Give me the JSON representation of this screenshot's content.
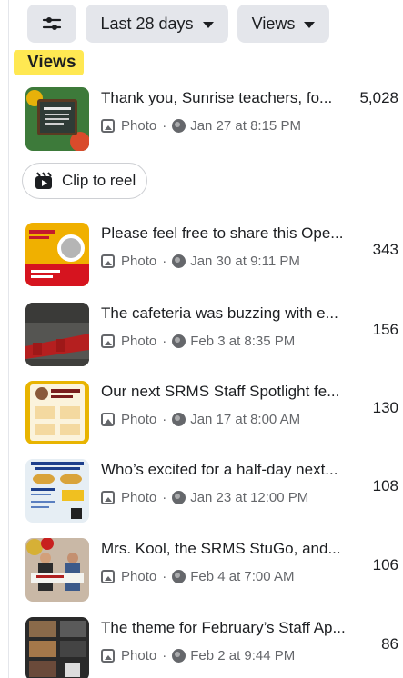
{
  "filters": {
    "date_range": "Last 28 days",
    "metric": "Views"
  },
  "sort_label": "Views",
  "reel_button": "Clip to reel",
  "posts": [
    {
      "title": "Thank you, Sunrise teachers, fo...",
      "type": "Photo",
      "date": "Jan 27 at 8:15 PM",
      "views": "5,028",
      "thumb_color": "#3d7a3a"
    },
    {
      "title": "Please feel free to share this Ope...",
      "type": "Photo",
      "date": "Jan 30 at 9:11 PM",
      "views": "343",
      "thumb_color": "#f0b000"
    },
    {
      "title": "The cafeteria was buzzing with e...",
      "type": "Photo",
      "date": "Feb 3 at 8:35 PM",
      "views": "156",
      "thumb_color": "#a52424"
    },
    {
      "title": "Our next SRMS Staff Spotlight fe...",
      "type": "Photo",
      "date": "Jan 17 at 8:00 AM",
      "views": "130",
      "thumb_color": "#e8b400"
    },
    {
      "title": "Who’s excited for a half-day next...",
      "type": "Photo",
      "date": "Jan 23 at 12:00 PM",
      "views": "108",
      "thumb_color": "#e6eef4"
    },
    {
      "title": "Mrs. Kool, the SRMS StuGo, and...",
      "type": "Photo",
      "date": "Feb 4 at 7:00 AM",
      "views": "106",
      "thumb_color": "#8a4a32"
    },
    {
      "title": "The theme for February’s Staff Ap...",
      "type": "Photo",
      "date": "Feb 2 at 9:44 PM",
      "views": "86",
      "thumb_color": "#2a2a2a"
    }
  ],
  "colors": {
    "highlight": "#ffe852",
    "chip_bg": "#e4e6eb",
    "meta_text": "#65676b"
  },
  "icons": [
    "filter-sliders-icon",
    "caret-down-icon",
    "photo-icon",
    "globe-icon",
    "reel-icon"
  ]
}
